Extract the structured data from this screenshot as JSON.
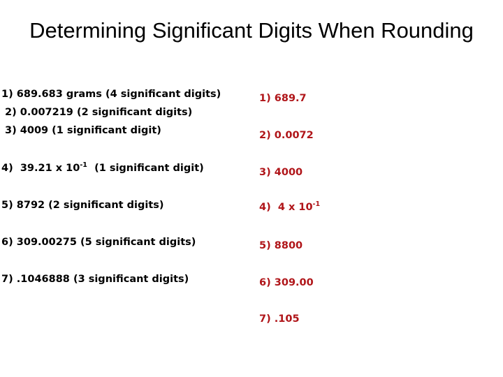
{
  "slide": {
    "title": "Determining Significant Digits When Rounding",
    "background_color": "#FFFFFF",
    "problem_text_color": "#000000",
    "answer_text_color": "#B01519"
  },
  "problems": {
    "heading_visible": false,
    "items": [
      {
        "marker": "1)",
        "value": "689.683 grams",
        "instruction": "(4 significant digits)",
        "text": "1)  689.683 grams  (4 significant digits)",
        "has_exponent": false
      },
      {
        "marker": "2)",
        "value": "0.007219",
        "instruction": "(2 significant digits)",
        "text": "2)  0.007219  (2 significant digits)",
        "has_exponent": false
      },
      {
        "marker": "3)",
        "value": "4009",
        "instruction": "(1 significant digit)",
        "text": "3)  4009  (1 significant digit)",
        "has_exponent": false
      },
      {
        "marker": "4)",
        "value_before_exponent": "39.21 x 10",
        "exponent": "-1",
        "instruction": "(1 significant digit)",
        "text": "4)  39.21 x 10-1  (1 significant digit)",
        "has_exponent": true
      },
      {
        "marker": "5)",
        "value": "8792",
        "instruction": "(2 significant digits)",
        "text": "5)  8792  (2 significant digits)",
        "has_exponent": false
      },
      {
        "marker": "6)",
        "value": "309.00275",
        "instruction": "(5 significant digits)",
        "text": "6)  309.00275  (5 significant digits)",
        "has_exponent": false
      },
      {
        "marker": "7)",
        "value": ".1046888",
        "instruction": "(3 significant digits)",
        "text": "7)  .1046888  (3 significant digits)",
        "has_exponent": false
      }
    ]
  },
  "answers": {
    "items": [
      {
        "marker": "1)",
        "value": "689.7",
        "text": "1)  689.7",
        "has_exponent": false
      },
      {
        "marker": "2)",
        "value": "0.0072",
        "text": "2)  0.0072",
        "has_exponent": false
      },
      {
        "marker": "3)",
        "value": "4000",
        "text": "3)  4000",
        "has_exponent": false
      },
      {
        "marker": "4)",
        "value_before_exponent": "4 x 10",
        "exponent": "-1",
        "text": "4)  4 x 10-1",
        "has_exponent": true
      },
      {
        "marker": "5)",
        "value": "8800",
        "text": "5)  8800",
        "has_exponent": false
      },
      {
        "marker": "6)",
        "value": "309.00",
        "text": "6)  309.00",
        "has_exponent": false
      },
      {
        "marker": "7)",
        "value": ".105",
        "text": "7)  .105",
        "has_exponent": false
      }
    ]
  }
}
